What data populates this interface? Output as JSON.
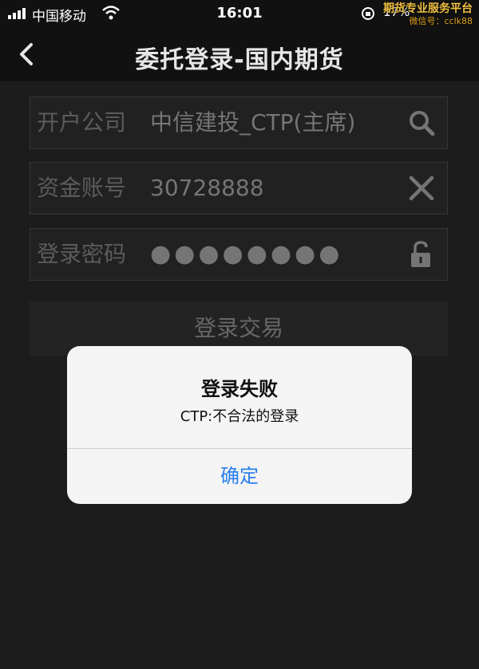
{
  "status": {
    "carrier": "中国移动",
    "time": "16:01",
    "battery": "17%",
    "watermark_title": "期货专业服务平台",
    "watermark_sub": "微信号：cclk88"
  },
  "nav": {
    "title": "委托登录-国内期货"
  },
  "form": {
    "company_label": "开户公司",
    "company_value": "中信建投_CTP(主席)",
    "account_label": "资金账号",
    "account_value": "30728888",
    "password_label": "登录密码",
    "password_value": "●●●●●●●●",
    "login_button": "登录交易"
  },
  "icons": {
    "search": "search-icon",
    "clear": "close-icon",
    "unlock": "unlock-icon",
    "back": "chevron-left-icon"
  },
  "alert": {
    "title": "登录失败",
    "message": "CTP:不合法的登录",
    "confirm": "确定"
  },
  "colors": {
    "background": "#262626",
    "header": "#111111",
    "alert_button": "#2a7ef0",
    "watermark": "#e0a21c"
  }
}
